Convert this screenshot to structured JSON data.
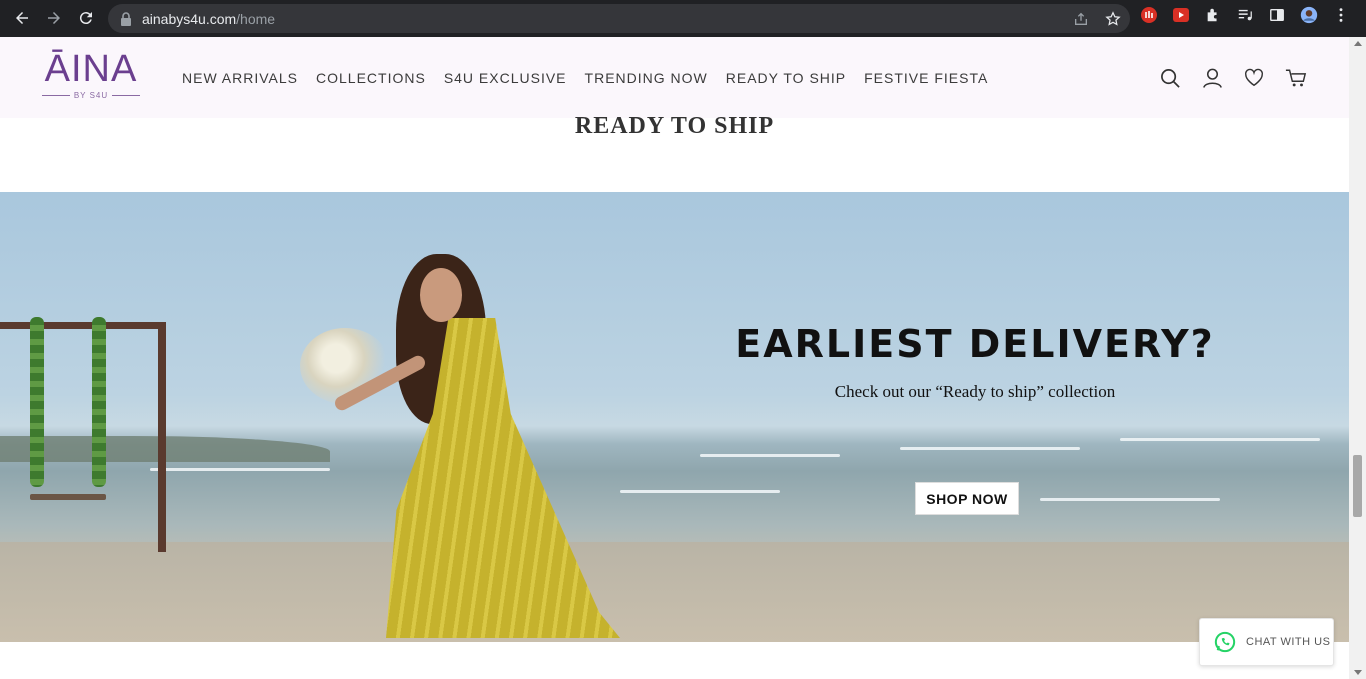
{
  "browser": {
    "url_host": "ainabys4u.com",
    "url_path": "/home"
  },
  "header": {
    "logo_main": "ĀINA",
    "logo_sub": "BY S4U",
    "menu": [
      {
        "label": "NEW ARRIVALS"
      },
      {
        "label": "COLLECTIONS"
      },
      {
        "label": "S4U EXCLUSIVE"
      },
      {
        "label": "TRENDING NOW"
      },
      {
        "label": "READY TO SHIP"
      },
      {
        "label": "FESTIVE FIESTA"
      }
    ]
  },
  "section": {
    "title": "READY TO SHIP"
  },
  "banner": {
    "heading": "EARLIEST DELIVERY?",
    "subheading": "Check out our “Ready to ship” collection",
    "button_label": "SHOP NOW"
  },
  "chat": {
    "label": "CHAT WITH US"
  },
  "colors": {
    "brand": "#6b3f8f",
    "header_bg": "#fbf7fc",
    "chrome_bg": "#202124",
    "whatsapp": "#25d366"
  }
}
